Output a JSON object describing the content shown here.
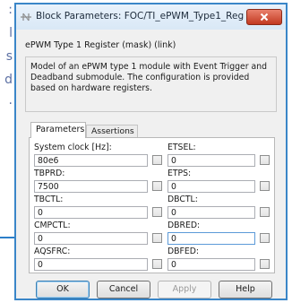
{
  "background": {
    "fragments": [
      ":",
      "l",
      "s",
      "d",
      "."
    ]
  },
  "dialog": {
    "title": "Block Parameters: FOC/TI_ePWM_Type1_Reg",
    "mask_title": "ePWM Type 1 Register (mask) (link)",
    "description": "Model of an ePWM type 1 module with Event Trigger and Deadband submodule. The configuration is provided based on hardware registers.",
    "tabs": [
      {
        "label": "Parameters",
        "active": true
      },
      {
        "label": "Assertions",
        "active": false
      }
    ],
    "params": [
      {
        "label": "System clock [Hz]:",
        "value": "80e6"
      },
      {
        "label": "ETSEL:",
        "value": "0"
      },
      {
        "label": "TBPRD:",
        "value": "7500"
      },
      {
        "label": "ETPS:",
        "value": "0"
      },
      {
        "label": "TBCTL:",
        "value": "0"
      },
      {
        "label": "DBCTL:",
        "value": "0"
      },
      {
        "label": "CMPCTL:",
        "value": "0"
      },
      {
        "label": "DBRED:",
        "value": "0"
      },
      {
        "label": "AQSFRC:",
        "value": "0"
      },
      {
        "label": "DBFED:",
        "value": "0"
      }
    ],
    "buttons": {
      "ok": "OK",
      "cancel": "Cancel",
      "apply": "Apply",
      "help": "Help"
    }
  },
  "colors": {
    "title_bar": "#dbe9f7",
    "close_button": "#c7432a",
    "border_accent": "#3a86c8"
  }
}
